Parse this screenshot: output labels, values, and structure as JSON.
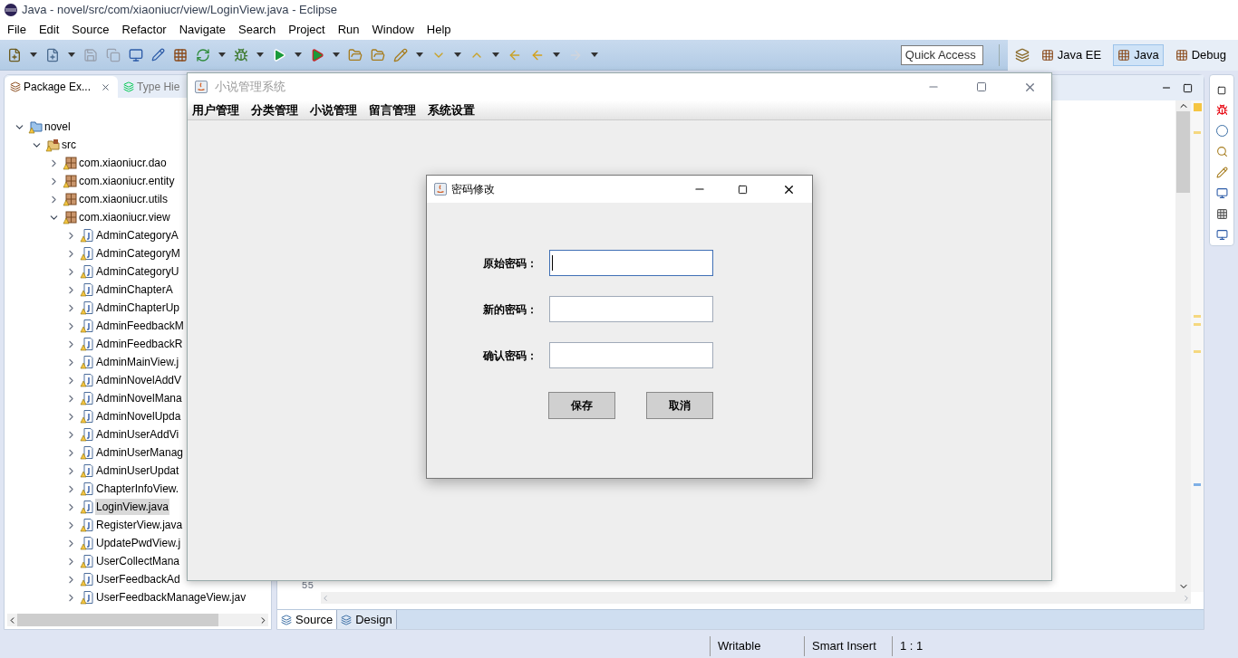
{
  "eclipse": {
    "title": "Java - novel/src/com/xiaoniucr/view/LoginView.java - Eclipse",
    "menu": [
      "File",
      "Edit",
      "Source",
      "Refactor",
      "Navigate",
      "Search",
      "Project",
      "Run",
      "Window",
      "Help"
    ],
    "quick_access": {
      "placeholder": "Quick Access"
    },
    "perspectives": [
      {
        "label": "Java EE",
        "selected": false
      },
      {
        "label": "Java",
        "selected": true
      },
      {
        "label": "Debug",
        "selected": false
      }
    ]
  },
  "package_explorer": {
    "tabs": [
      {
        "label": "Package Ex...",
        "selected": true
      },
      {
        "label": "Type Hie",
        "selected": false
      }
    ],
    "tree": [
      {
        "label": "novel",
        "kind": "project",
        "expanded": true,
        "children": [
          {
            "label": "src",
            "kind": "folder",
            "expanded": true,
            "children": [
              {
                "label": "com.xiaoniucr.dao",
                "kind": "package",
                "expanded": false
              },
              {
                "label": "com.xiaoniucr.entity",
                "kind": "package",
                "expanded": false
              },
              {
                "label": "com.xiaoniucr.utils",
                "kind": "package",
                "expanded": false
              },
              {
                "label": "com.xiaoniucr.view",
                "kind": "package",
                "expanded": true,
                "children": [
                  {
                    "label": "AdminCategoryA",
                    "kind": "file",
                    "selected": false
                  },
                  {
                    "label": "AdminCategoryM",
                    "kind": "file",
                    "selected": false
                  },
                  {
                    "label": "AdminCategoryU",
                    "kind": "file",
                    "selected": false
                  },
                  {
                    "label": "AdminChapterA",
                    "kind": "file",
                    "selected": false
                  },
                  {
                    "label": "AdminChapterUp",
                    "kind": "file",
                    "selected": false
                  },
                  {
                    "label": "AdminFeedbackM",
                    "kind": "file",
                    "selected": false
                  },
                  {
                    "label": "AdminFeedbackR",
                    "kind": "file",
                    "selected": false
                  },
                  {
                    "label": "AdminMainView.j",
                    "kind": "file",
                    "selected": false
                  },
                  {
                    "label": "AdminNovelAddV",
                    "kind": "file",
                    "selected": false
                  },
                  {
                    "label": "AdminNovelMana",
                    "kind": "file",
                    "selected": false
                  },
                  {
                    "label": "AdminNovelUpda",
                    "kind": "file",
                    "selected": false
                  },
                  {
                    "label": "AdminUserAddVi",
                    "kind": "file",
                    "selected": false
                  },
                  {
                    "label": "AdminUserManag",
                    "kind": "file",
                    "selected": false
                  },
                  {
                    "label": "AdminUserUpdat",
                    "kind": "file",
                    "selected": false
                  },
                  {
                    "label": "ChapterInfoView.",
                    "kind": "file",
                    "selected": false
                  },
                  {
                    "label": "LoginView.java",
                    "kind": "file",
                    "selected": true
                  },
                  {
                    "label": "RegisterView.java",
                    "kind": "file",
                    "selected": false
                  },
                  {
                    "label": "UpdatePwdView.j",
                    "kind": "file",
                    "selected": false
                  },
                  {
                    "label": "UserCollectMana",
                    "kind": "file",
                    "selected": false
                  },
                  {
                    "label": "UserFeedbackAd",
                    "kind": "file",
                    "selected": false
                  },
                  {
                    "label": "UserFeedbackManageView.jav",
                    "kind": "file",
                    "selected": false
                  }
                ]
              }
            ]
          }
        ]
      }
    ]
  },
  "editor": {
    "line_number": "55",
    "tabs": [
      {
        "label": "Source",
        "selected": true
      },
      {
        "label": "Design",
        "selected": false
      }
    ]
  },
  "status_bar": [
    "Writable",
    "Smart Insert",
    "1 : 1"
  ],
  "app_window": {
    "title": "小说管理系统",
    "menu": [
      "用户管理",
      "分类管理",
      "小说管理",
      "留言管理",
      "系统设置"
    ]
  },
  "dialog": {
    "title": "密码修改",
    "fields": [
      {
        "label": "原始密码：",
        "focused": true
      },
      {
        "label": "新的密码：",
        "focused": false
      },
      {
        "label": "确认密码：",
        "focused": false
      }
    ],
    "buttons": [
      "保存",
      "取消"
    ]
  }
}
